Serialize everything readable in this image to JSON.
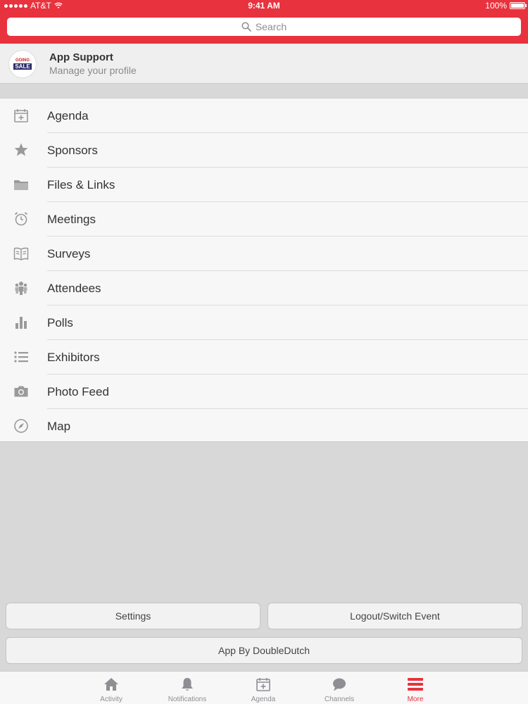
{
  "status": {
    "carrier": "AT&T",
    "time": "9:41 AM",
    "battery": "100%"
  },
  "search": {
    "placeholder": "Search"
  },
  "profile": {
    "name": "App Support",
    "subtitle": "Manage your profile",
    "logo_text": [
      "GOING",
      "SALE"
    ]
  },
  "menu": [
    {
      "label": "Agenda",
      "icon": "calendar-plus-icon"
    },
    {
      "label": "Sponsors",
      "icon": "star-icon"
    },
    {
      "label": "Files & Links",
      "icon": "folder-icon"
    },
    {
      "label": "Meetings",
      "icon": "alarm-clock-icon"
    },
    {
      "label": "Surveys",
      "icon": "open-book-icon"
    },
    {
      "label": "Attendees",
      "icon": "people-icon"
    },
    {
      "label": "Polls",
      "icon": "bar-chart-icon"
    },
    {
      "label": "Exhibitors",
      "icon": "list-icon"
    },
    {
      "label": "Photo Feed",
      "icon": "camera-icon"
    },
    {
      "label": "Map",
      "icon": "compass-icon"
    }
  ],
  "buttons": {
    "settings": "Settings",
    "logout": "Logout/Switch Event",
    "app_by": "App By DoubleDutch"
  },
  "tabs": [
    {
      "label": "Activity",
      "icon": "home-icon"
    },
    {
      "label": "Notifications",
      "icon": "bell-icon"
    },
    {
      "label": "Agenda",
      "icon": "calendar-plus-icon"
    },
    {
      "label": "Channels",
      "icon": "chat-bubble-icon"
    },
    {
      "label": "More",
      "icon": "hamburger-menu-icon",
      "active": true
    }
  ],
  "colors": {
    "accent": "#e8323e",
    "icon_gray": "#9a9a9a",
    "background": "#d8d8d8"
  }
}
